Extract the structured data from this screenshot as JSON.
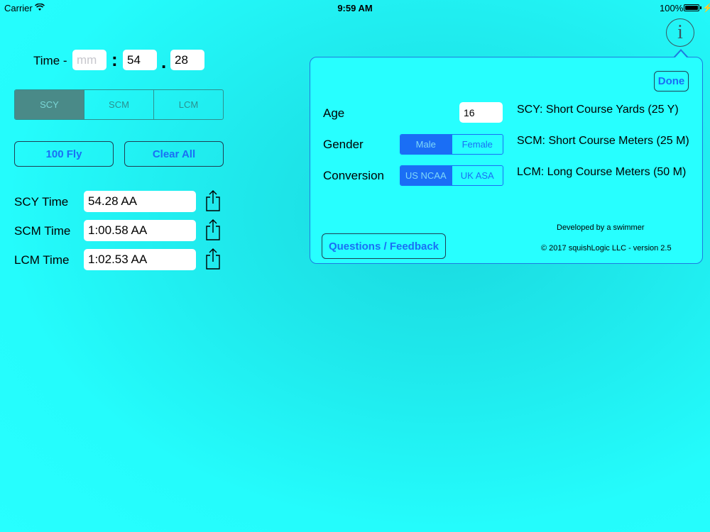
{
  "status_bar": {
    "carrier": "Carrier",
    "time": "9:59 AM",
    "battery": "100%"
  },
  "time_entry": {
    "label": "Time -",
    "minutes_placeholder": "mm",
    "minutes_value": "",
    "separator_colon": ":",
    "seconds_value": "54",
    "separator_dot": ".",
    "hundredths_value": "28"
  },
  "course_segment": {
    "options": [
      "SCY",
      "SCM",
      "LCM"
    ],
    "selected": "SCY"
  },
  "buttons": {
    "event": "100 Fly",
    "clear": "Clear All"
  },
  "results": [
    {
      "label": "SCY Time",
      "value": "54.28 AA"
    },
    {
      "label": "SCM Time",
      "value": "1:00.58 AA"
    },
    {
      "label": "LCM Time",
      "value": "1:02.53 AA"
    }
  ],
  "info_button": {
    "glyph": "i",
    "icon": "info-icon"
  },
  "popover": {
    "done": "Done",
    "age_label": "Age",
    "age_value": "16",
    "gender_label": "Gender",
    "gender_options": [
      "Male",
      "Female"
    ],
    "gender_selected": "Male",
    "conversion_label": "Conversion",
    "conversion_options": [
      "US NCAA",
      "UK ASA"
    ],
    "conversion_selected": "US NCAA",
    "legend": [
      "SCY: Short Course Yards (25 Y)",
      "SCM: Short Course Meters (25 M)",
      "LCM: Long Course Meters (50 M)"
    ],
    "developed_by": "Developed by a swimmer",
    "copyright": "© 2017 squishLogic LLC - version 2.5",
    "feedback": "Questions / Feedback"
  },
  "colors": {
    "background": "#27ffff",
    "accent": "#1a6ef5"
  }
}
